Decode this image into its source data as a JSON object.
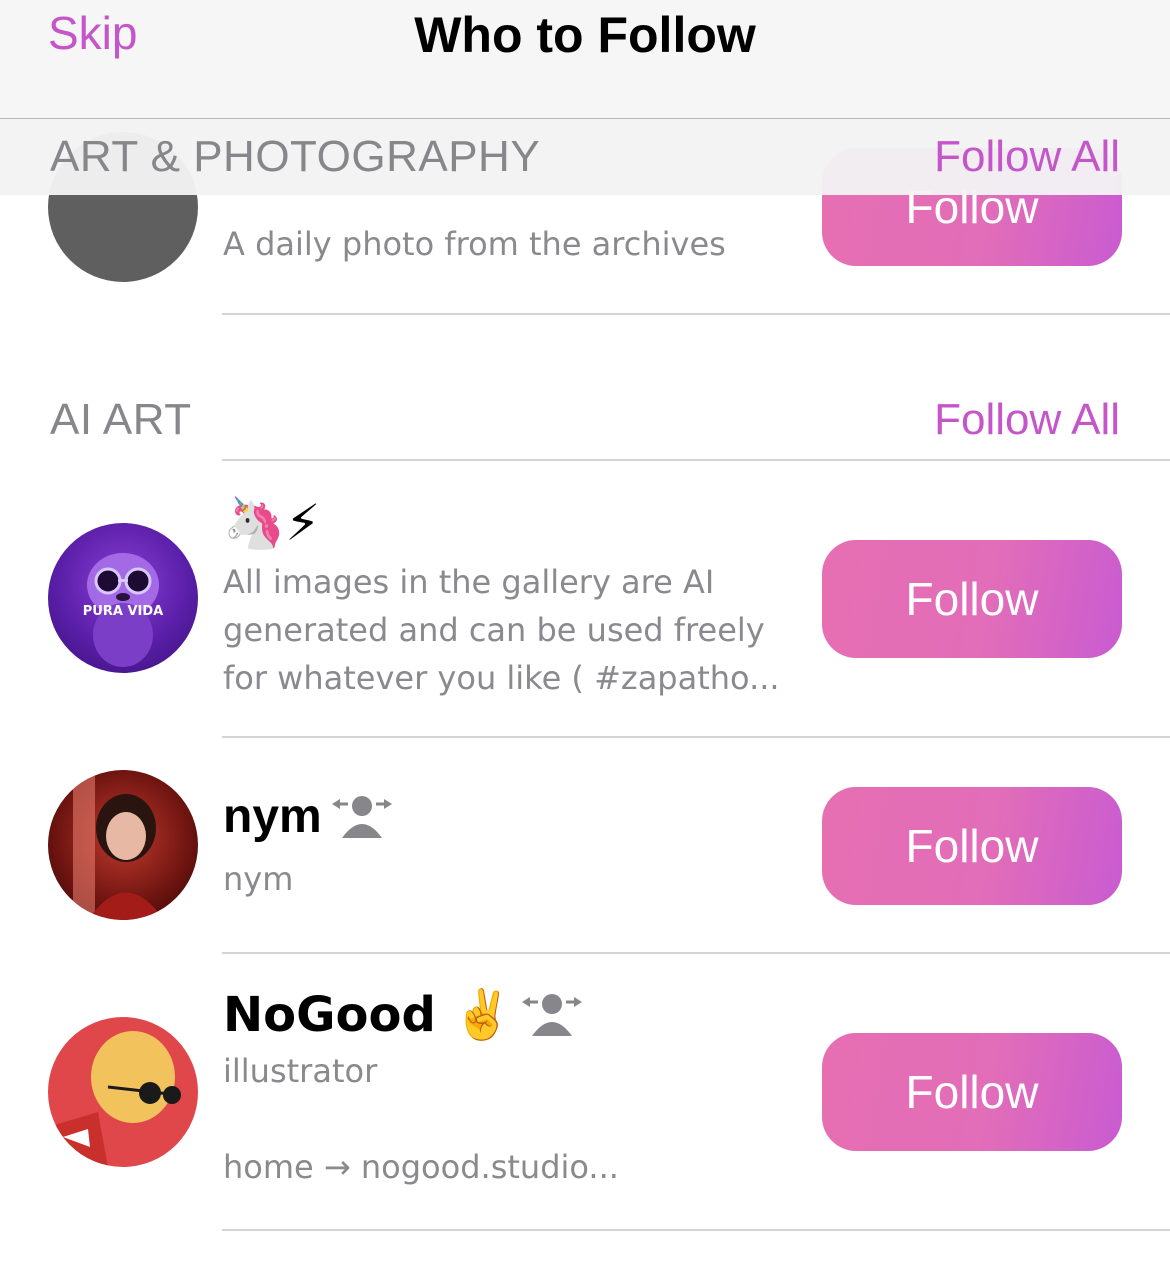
{
  "nav": {
    "skip_label": "Skip",
    "title": "Who to Follow"
  },
  "sections": [
    {
      "title": "ART & PHOTOGRAPHY",
      "follow_all_label": "Follow All",
      "items": [
        {
          "name": "",
          "description": "A daily photo from the archives",
          "follow_label": "Follow",
          "avatar_color": "#5f5f5f"
        }
      ]
    },
    {
      "title": "AI ART",
      "follow_all_label": "Follow All",
      "items": [
        {
          "name": "🦄⚡",
          "description": "All images in the gallery are AI generated and can be used freely for whatever you like ( #zapatho...",
          "follow_label": "Follow",
          "avatar_text": "PURA VIDA"
        },
        {
          "name": "nym",
          "description": "nym",
          "follow_label": "Follow",
          "icon": "follow-request-icon"
        },
        {
          "name": "NoGood ✌️",
          "description": "illustrator",
          "description_2": "home → nogood.studio...",
          "follow_label": "Follow",
          "icon": "follow-request-icon"
        }
      ]
    }
  ],
  "colors": {
    "accent": "#c456c9",
    "button_start": "#e66fb2",
    "button_end": "#c95bd1",
    "section_text": "#86868b",
    "secondary_text": "#8a8a8e"
  }
}
